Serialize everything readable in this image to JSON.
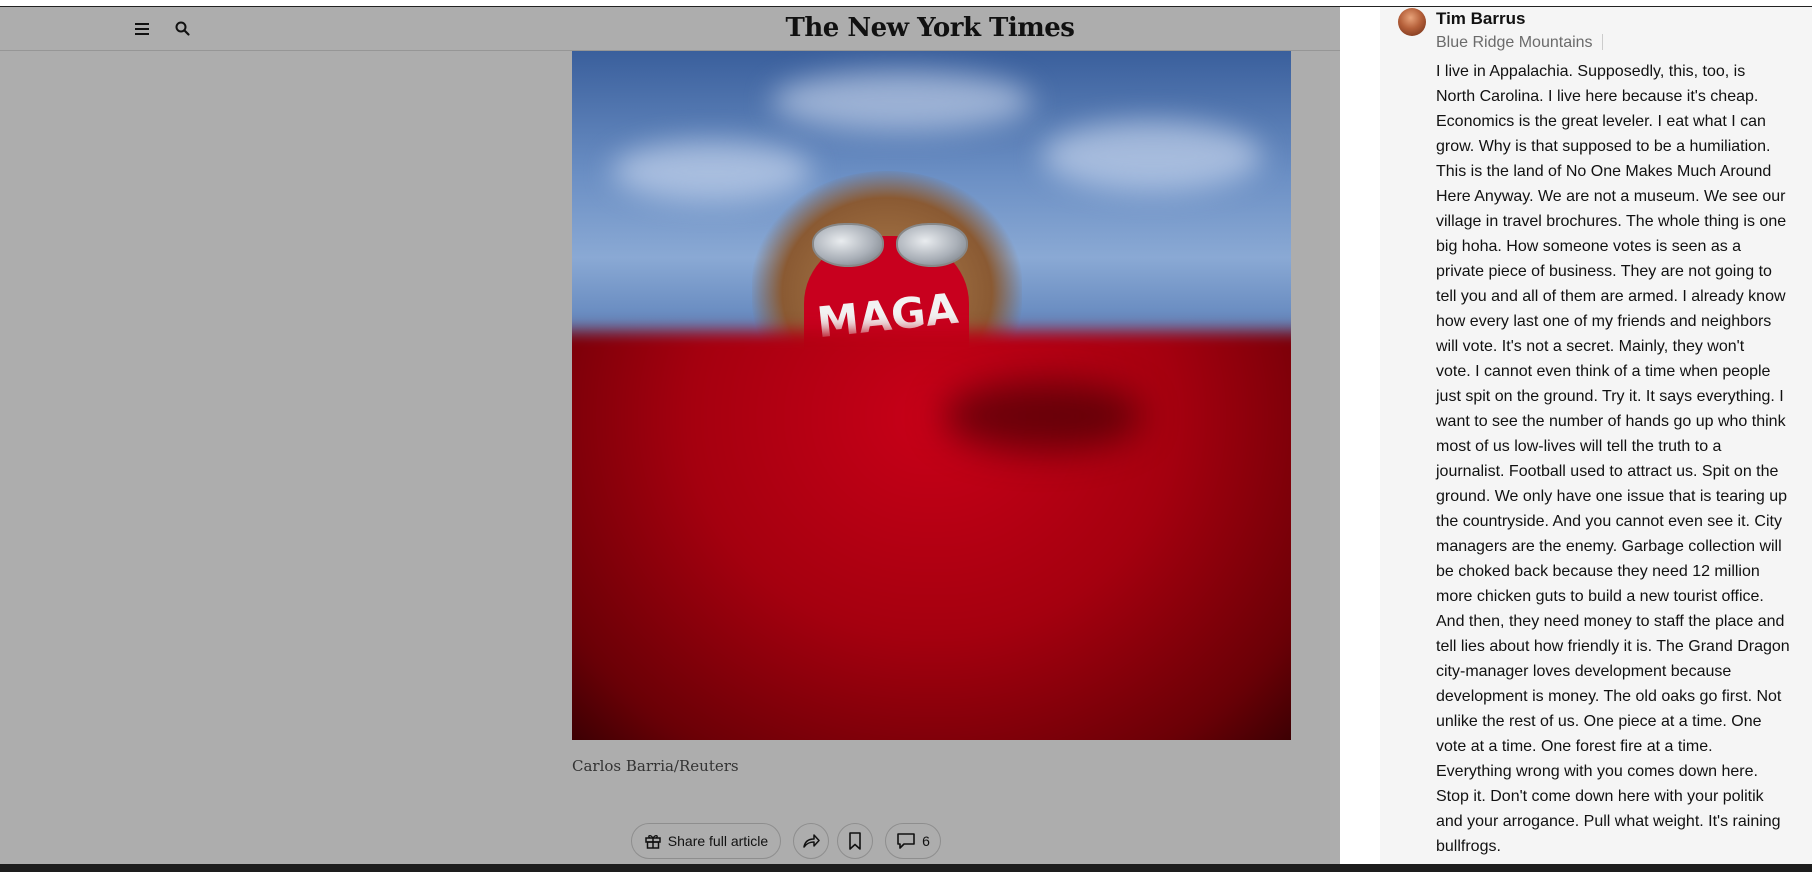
{
  "masthead": {
    "logo": "The New York Times",
    "menu_icon": "hamburger-menu-icon",
    "search_icon": "search-icon"
  },
  "photo": {
    "mask_text": "MAGA",
    "caption": "Carlos Barria/Reuters"
  },
  "actions": {
    "share_label": "Share full article",
    "comment_count": "6",
    "icons": [
      "gift-icon",
      "share-arrow-icon",
      "bookmark-icon",
      "comment-bubble-icon"
    ]
  },
  "comment": {
    "author": "Tim Barrus",
    "location": "Blue Ridge Mountains",
    "lines": [
      "I live in Appalachia. Supposedly, this, too, is",
      "North Carolina. I live here because it's cheap.",
      "Economics is the great leveler. I eat what I can",
      "grow. Why is that supposed to be a humiliation.",
      "This is the land of No One Makes Much Around",
      "Here Anyway. We are not a museum. We see our",
      "village in travel brochures. The whole thing is one",
      "big hoha. How someone votes is seen as a",
      "private piece of business. They are not going to",
      "tell you and all of them are armed. I already know",
      "how every last one of my friends and neighbors",
      "will vote. It's not a secret. Mainly, they won't",
      "vote. I cannot even think of a time when people",
      "just spit on the ground. Try it. It says everything. I",
      "want to see the number of hands go up who think",
      "most of us low-lives will tell the truth to a",
      "journalist. Football used to attract us. Spit on the",
      "ground. We only have one issue that is tearing up",
      "the countryside. And you cannot even see it. City",
      "managers are the enemy. Garbage collection will",
      "be choked back because they need 12 million",
      "more chicken guts to build a new tourist office.",
      "And then, they need money to staff the place and",
      "tell lies about how friendly it is. The Grand Dragon",
      "city-manager loves development because",
      "development is money. The old oaks go first. Not",
      "unlike the rest of us. One piece at a time. One",
      "vote at a time. One forest fire at a time.",
      "Everything wrong with you comes down here.",
      "Stop it. Don't come down here with your politik",
      "and your arrogance. Pull what weight. It's raining",
      "bullfrogs."
    ]
  }
}
